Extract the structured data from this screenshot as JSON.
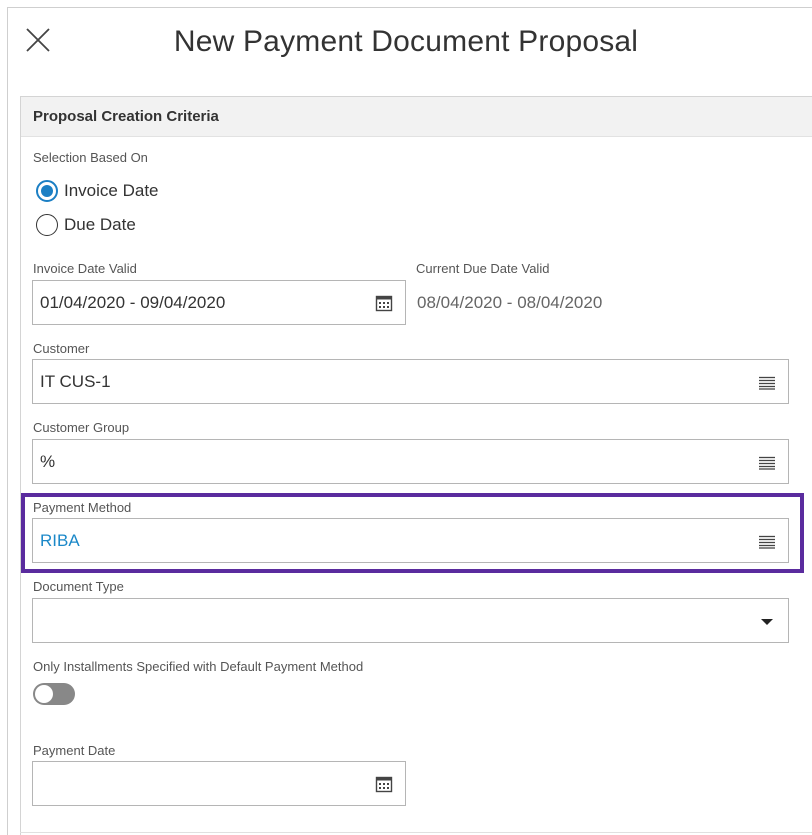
{
  "dialog": {
    "title": "New Payment Document Proposal"
  },
  "panel": {
    "header": "Proposal Creation Criteria"
  },
  "selection": {
    "label": "Selection Based On",
    "options": [
      {
        "label": "Invoice Date",
        "checked": true
      },
      {
        "label": "Due Date",
        "checked": false
      }
    ]
  },
  "invoice_date_valid": {
    "label": "Invoice Date Valid",
    "value": "01/04/2020 - 09/04/2020"
  },
  "current_due_date_valid": {
    "label": "Current Due Date Valid",
    "value": "08/04/2020 - 08/04/2020"
  },
  "customer": {
    "label": "Customer",
    "value": "IT CUS-1"
  },
  "customer_group": {
    "label": "Customer Group",
    "value": "%"
  },
  "payment_method": {
    "label": "Payment Method",
    "value": "RIBA"
  },
  "document_type": {
    "label": "Document Type",
    "value": ""
  },
  "only_installments": {
    "label": "Only Installments Specified with Default Payment Method",
    "enabled": false
  },
  "payment_date": {
    "label": "Payment Date",
    "value": ""
  },
  "colors": {
    "accent": "#1b7fc4",
    "link": "#1b88c8",
    "highlight": "#5a2b9e"
  }
}
